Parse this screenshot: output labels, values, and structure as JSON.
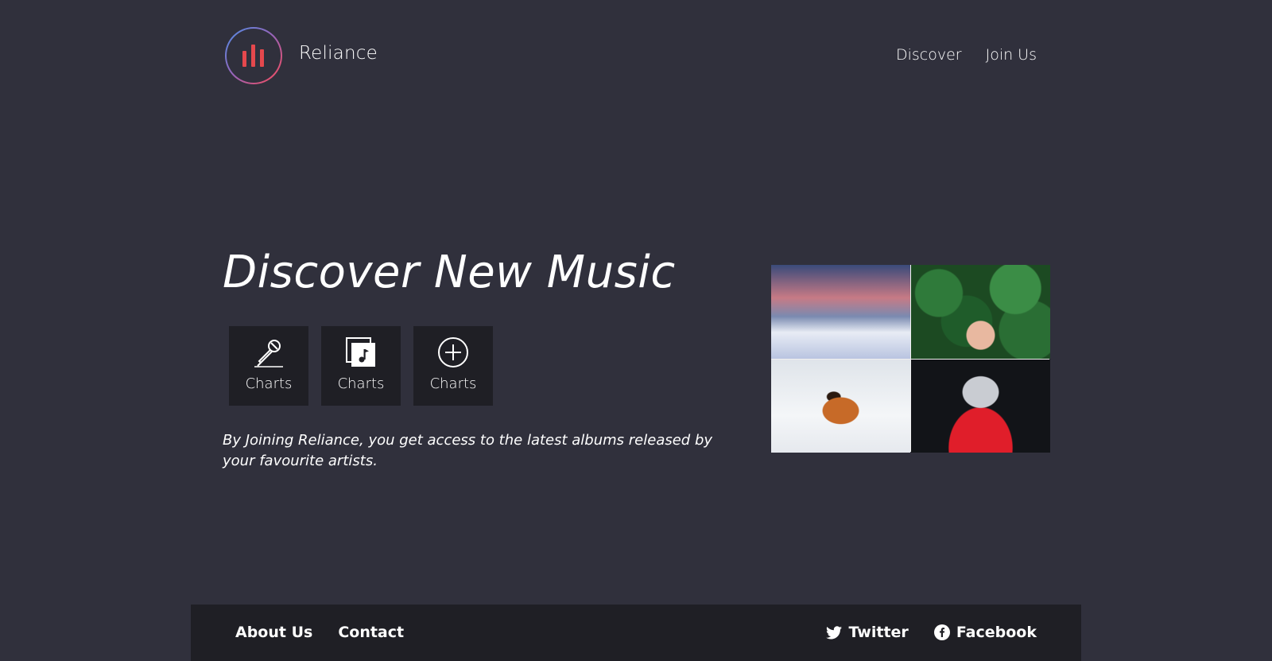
{
  "brand": {
    "name": "Reliance",
    "logo_icon": "equalizer-bars-icon",
    "accent": "#e5484d",
    "ring_gradient": [
      "#4d8fe8",
      "#ff4a55"
    ]
  },
  "nav": {
    "items": [
      {
        "label": "Discover"
      },
      {
        "label": "Join Us"
      }
    ]
  },
  "hero": {
    "title": "Discover New Music",
    "description": "By Joining Reliance, you get access to the latest albums released by your favourite artists.",
    "tiles": [
      {
        "label": "Charts",
        "icon": "microphone-icon"
      },
      {
        "label": "Charts",
        "icon": "music-album-icon"
      },
      {
        "label": "Charts",
        "icon": "plus-circle-icon"
      }
    ]
  },
  "gallery": {
    "images": [
      {
        "subject": "snowy mountain at sunset"
      },
      {
        "subject": "woman among green leaves"
      },
      {
        "subject": "tiger in snow"
      },
      {
        "subject": "person in red holding plastic bag"
      }
    ]
  },
  "footer": {
    "links": [
      {
        "label": "About Us"
      },
      {
        "label": "Contact"
      }
    ],
    "social": [
      {
        "label": "Twitter",
        "icon": "twitter-icon"
      },
      {
        "label": "Facebook",
        "icon": "facebook-icon"
      }
    ]
  },
  "colors": {
    "background": "#30303c",
    "panel": "#1f1f25",
    "text": "#ffffff"
  }
}
